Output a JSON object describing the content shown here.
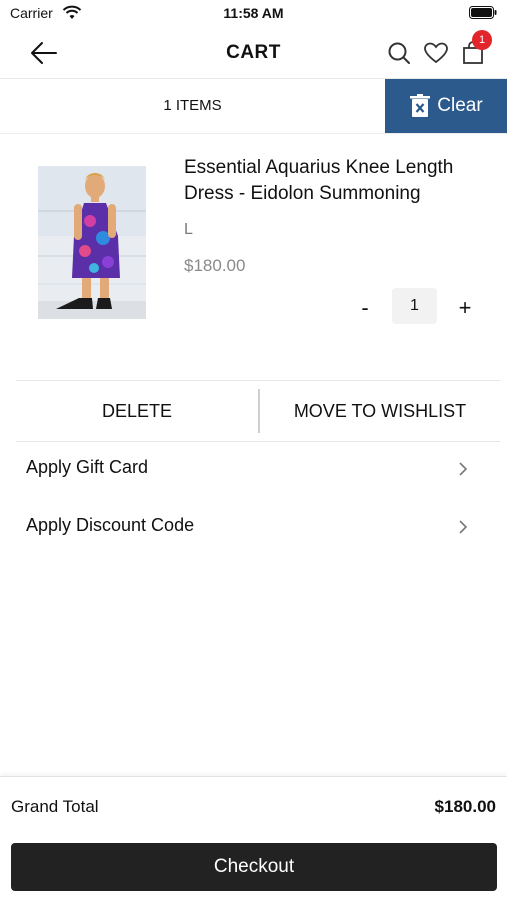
{
  "status_bar": {
    "carrier": "Carrier",
    "time": "11:58 AM"
  },
  "nav": {
    "title": "CART",
    "icons": [
      "back-arrow-icon",
      "search-icon",
      "heart-icon",
      "shopping-bag-icon"
    ],
    "cart_badge": "1"
  },
  "items_bar": {
    "count_text": "1 ITEMS",
    "clear_label": "Clear",
    "clear_color": "#2c5a8c"
  },
  "cart_item": {
    "name": "Essential Aquarius Knee Length Dress - Eidolon Summoning",
    "size": "L",
    "price": "$180.00",
    "qty_minus": "-",
    "quantity": "1",
    "qty_plus": "+"
  },
  "actions": {
    "delete_label": "DELETE",
    "wishlist_label": "MOVE TO WISHLIST"
  },
  "options": {
    "gift_card": "Apply Gift Card",
    "discount_code": "Apply Discount Code"
  },
  "footer": {
    "grand_total_label": "Grand Total",
    "grand_total_value": "$180.00",
    "checkout_label": "Checkout",
    "checkout_color": "#222222"
  }
}
